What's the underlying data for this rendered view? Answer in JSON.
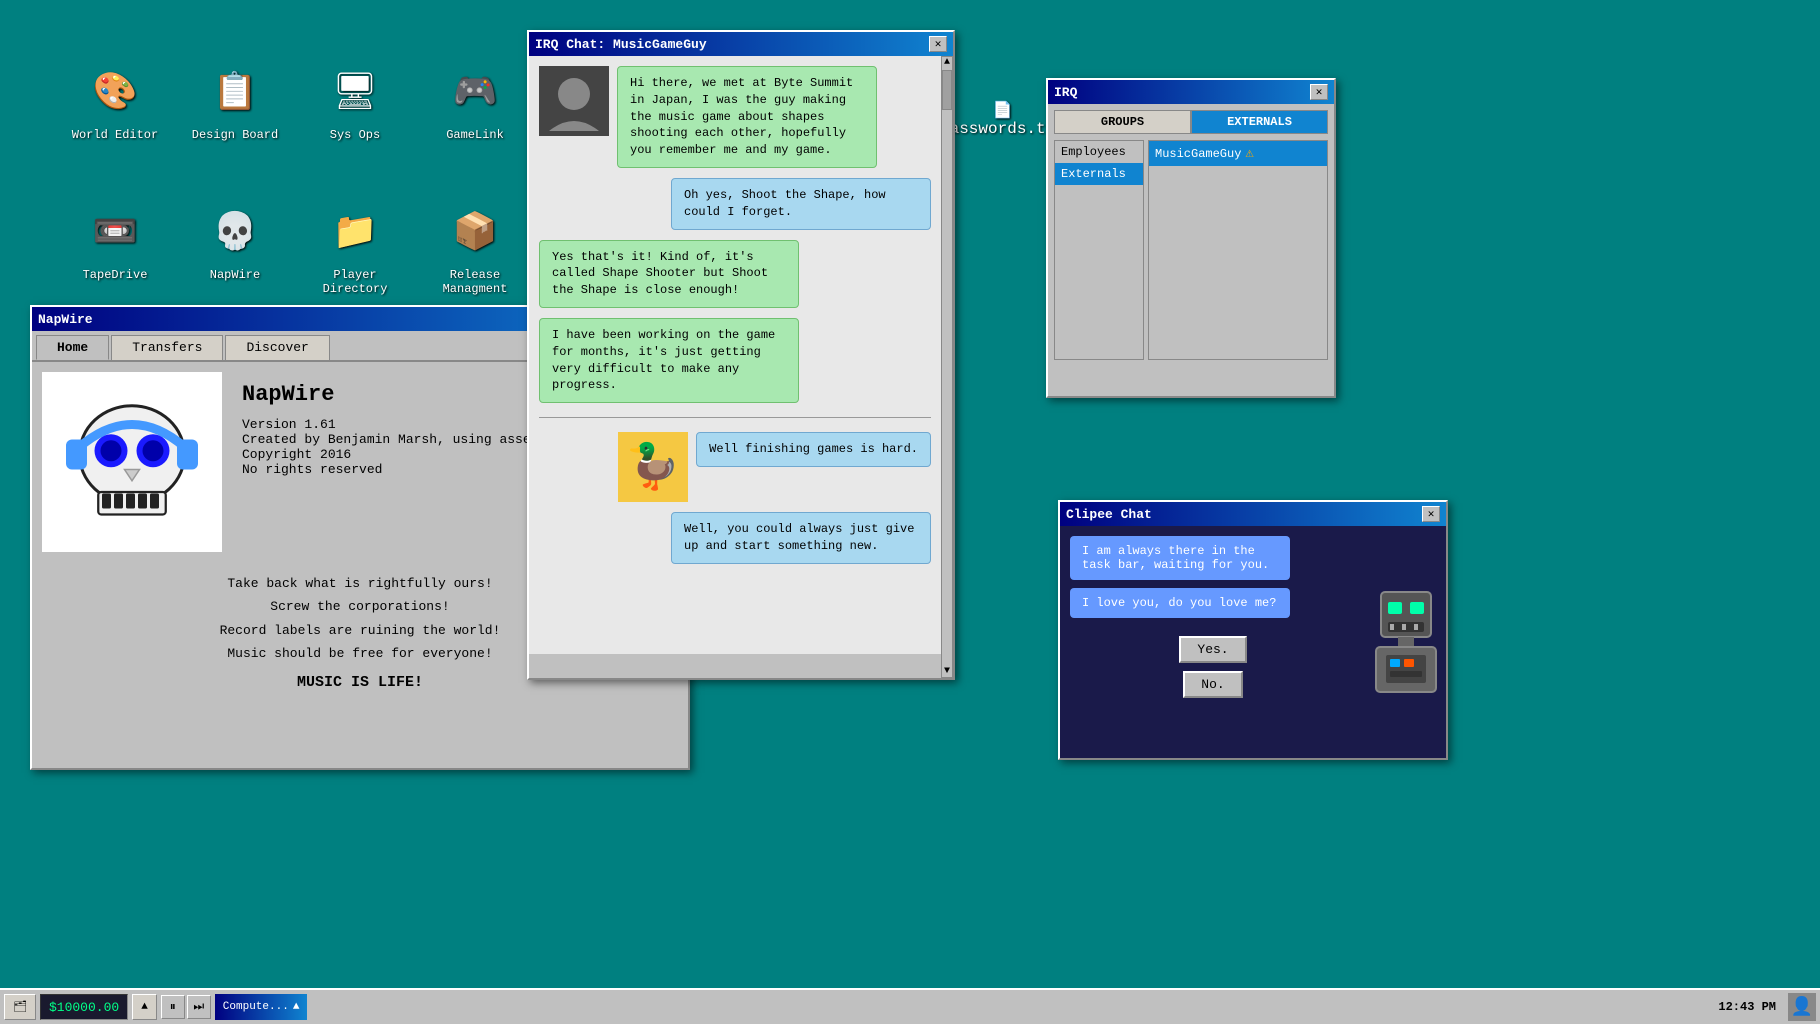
{
  "desktop": {
    "background_color": "#008080",
    "icons_row1": [
      {
        "id": "world-editor",
        "label": "World Editor",
        "emoji": "🎨"
      },
      {
        "id": "design-board",
        "label": "Design Board",
        "emoji": "📋"
      },
      {
        "id": "sys-ops",
        "label": "Sys Ops",
        "emoji": "🖥"
      },
      {
        "id": "gamelink",
        "label": "GameLink",
        "emoji": "🎮"
      }
    ],
    "icons_row2": [
      {
        "id": "tapedrive",
        "label": "TapeDrive",
        "emoji": "📼"
      },
      {
        "id": "napwire",
        "label": "NapWire",
        "emoji": "💀"
      },
      {
        "id": "player-directory",
        "label": "Player Directory",
        "emoji": "📁"
      },
      {
        "id": "release-management",
        "label": "Release Managment",
        "emoji": "📦"
      }
    ],
    "passwords_icon": {
      "label": "Passwords.txt",
      "emoji": "📄"
    }
  },
  "napwire_window": {
    "title": "NapWire",
    "tabs": [
      "Home",
      "Transfers",
      "Discover"
    ],
    "active_tab": "Home",
    "app_name": "NapWire",
    "version": "Version 1.61",
    "created_by": "Created by Benjamin Marsh, using assembly.",
    "copyright": "Copyright 2016",
    "rights": "No rights reserved",
    "slogans": [
      "Take back what is rightfully ours!",
      "Screw the corporations!",
      "Record labels are ruining the world!",
      "Music should be free for everyone!",
      "",
      "MUSIC IS LIFE!"
    ]
  },
  "irq_chat_window": {
    "title": "IRQ Chat: MusicGameGuy",
    "messages": [
      {
        "side": "left",
        "text": "Hi there, we met at Byte Summit in Japan, I was the guy making the music game about shapes shooting each other, hopefully you remember me and my game.",
        "type": "sender",
        "has_avatar": true
      },
      {
        "side": "right",
        "text": "Oh yes, Shoot the Shape, how could I forget.",
        "type": "receiver",
        "has_avatar": false
      },
      {
        "side": "left",
        "text": "Yes that's it! Kind of, it's called Shape Shooter but Shoot the Shape is close enough!",
        "type": "sender",
        "has_avatar": false
      },
      {
        "side": "left",
        "text": "I have been working on the game for months, it's just getting very difficult to make any progress.",
        "type": "sender",
        "has_avatar": false
      }
    ],
    "messages2": [
      {
        "side": "right",
        "text": "Well finishing games is hard.",
        "type": "receiver",
        "has_avatar": false
      },
      {
        "side": "right",
        "text": "Well, you could always just give up and start something new.",
        "type": "receiver",
        "has_avatar": false
      }
    ],
    "avatar_emoji": "👤",
    "duck_emoji": "🦆"
  },
  "irq_window": {
    "title": "IRQ",
    "close_btn": "✕",
    "tabs": [
      "GROUPS",
      "EXTERNALS"
    ],
    "active_tab": "EXTERNALS",
    "groups": [
      {
        "label": "Employees",
        "active": false
      },
      {
        "label": "Externals",
        "active": true
      }
    ],
    "users": [
      {
        "label": "MusicGameGuy",
        "warning": true,
        "selected": true
      }
    ]
  },
  "clipee_window": {
    "title": "Clipee Chat",
    "messages": [
      "I am always there in the task bar, waiting for you.",
      "I love you, do you love me?"
    ],
    "buttons": [
      "Yes.",
      "No."
    ]
  },
  "taskbar": {
    "money": "$10000.00",
    "media_controls": [
      "⏸",
      "⏭"
    ],
    "compute_label": "Compute...",
    "time": "12:43 PM",
    "triangle_up": "▲"
  }
}
